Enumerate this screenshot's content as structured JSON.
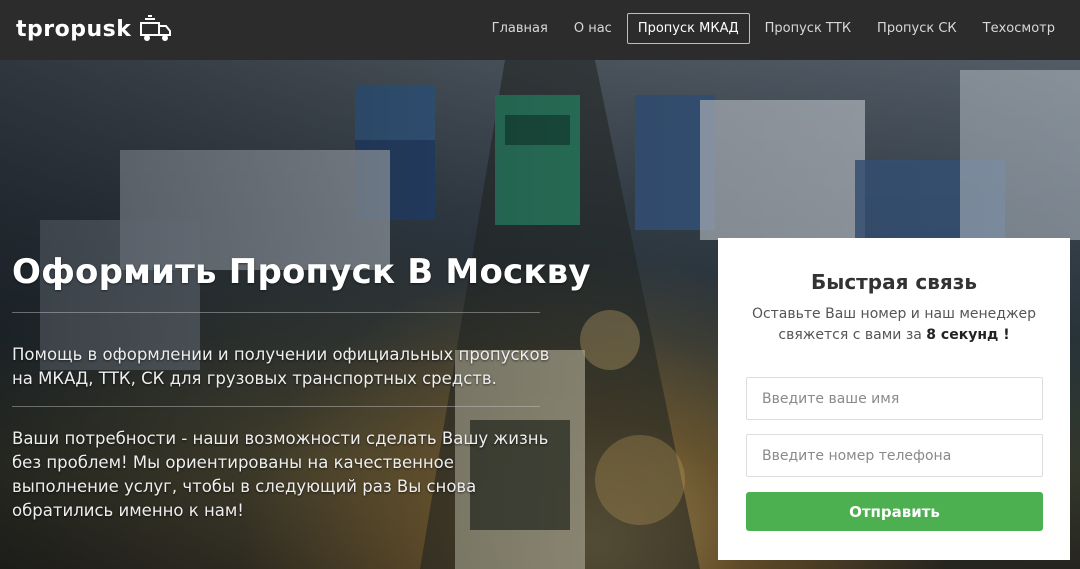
{
  "header": {
    "logo_text": "tpropusk",
    "nav": [
      {
        "label": "Главная"
      },
      {
        "label": "О нас"
      },
      {
        "label": "Пропуск МКАД",
        "active": true
      },
      {
        "label": "Пропуск ТТК"
      },
      {
        "label": "Пропуск СК"
      },
      {
        "label": "Техосмотр"
      }
    ]
  },
  "hero": {
    "title": "Оформить Пропуск В Москву",
    "paragraph1": "Помощь в оформлении и получении официальных пропусков на МКАД, ТТК, СК для грузовых транспортных средств.",
    "paragraph2": "Ваши потребности - наши возможности сделать Вашу жизнь без проблем! Мы ориентированы на качественное выполнение услуг, чтобы в следующий раз Вы снова обратились именно к нам!"
  },
  "form": {
    "title": "Быстрая связь",
    "subtitle_prefix": "Оставьте Ваш номер и наш менеджер свяжется с вами за",
    "subtitle_bold": "8 секунд !",
    "name_placeholder": "Введите ваше имя",
    "phone_placeholder": "Введите номер телефона",
    "submit_label": "Отправить"
  },
  "colors": {
    "header_bg": "#2c2c2c",
    "submit_bg": "#4caf50",
    "card_bg": "#ffffff"
  },
  "icons": [
    "truck-icon"
  ]
}
